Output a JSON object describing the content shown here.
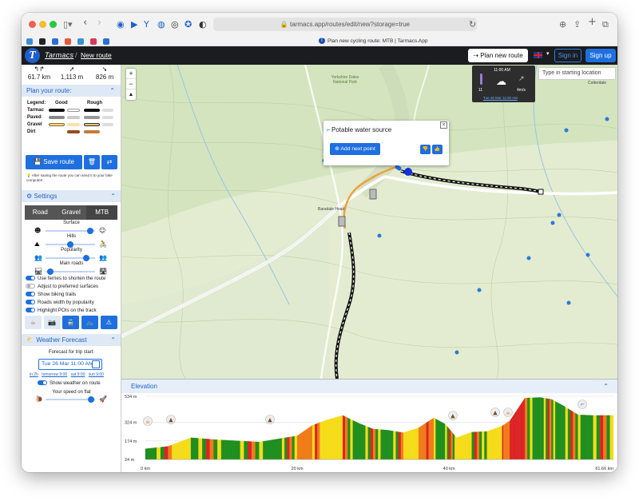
{
  "browser": {
    "url": "tarmacs.app/routes/edit/new?storage=true",
    "tab_title": "Plan new cycling route: MTB | Tarmacs.App"
  },
  "header": {
    "logo_letter": "T",
    "brand": "Tarmacs",
    "separator": "/",
    "breadcrumb": "New route",
    "plan_button": "Plan new route",
    "signin": "Sign in",
    "signup": "Sign up"
  },
  "stats": {
    "distance": "61.7 km",
    "ascent": "1,113 m",
    "descent": "826 m"
  },
  "plan": {
    "title": "Plan your route:",
    "legend_label": "Legend:",
    "good_label": "Good",
    "rough_label": "Rough",
    "surfaces": [
      "Tarmac",
      "Paved",
      "Gravel",
      "Dirt"
    ],
    "save_button": "Save route",
    "hint": "After saving the route you can send it to your bike computer!"
  },
  "settings": {
    "title": "Settings",
    "modes": [
      "Road",
      "Gravel",
      "MTB"
    ],
    "active_mode": "MTB",
    "sliders": [
      {
        "label": "Surface",
        "value": 0.9
      },
      {
        "label": "Hills",
        "value": 0.5
      },
      {
        "label": "Popularity",
        "value": 0.82
      },
      {
        "label": "Main roads",
        "value": 0.1
      }
    ],
    "toggles": [
      {
        "label": "Use ferries to shorten the route",
        "on": true
      },
      {
        "label": "Adjust to preferred surfaces",
        "on": false
      },
      {
        "label": "Show biking trails",
        "on": true
      },
      {
        "label": "Roads width by popularity",
        "on": true
      },
      {
        "label": "Highlight POIs on the track",
        "on": true
      }
    ]
  },
  "weather_panel": {
    "title": "Weather Forecast",
    "trip_label": "Forecast for trip start:",
    "date": "Tue 26 Mar 11:00 AM",
    "quick_links": [
      "in 2h",
      "tomorrow 9:00",
      "sat 9:00",
      "sun 9:00"
    ],
    "show_toggle": "Show weather on route",
    "speed_label": "Your speed on flat",
    "speed_value": 0.92
  },
  "map": {
    "search_placeholder": "Type in starting location",
    "popup_title": "Potable water source",
    "popup_button": "Add next point",
    "widget_time": "11:00 AM",
    "widget_temp": "11",
    "widget_wind": "4m/s",
    "widget_date": "Tue 26 Mar 11:00 AM",
    "place_labels": [
      "Yorkshire Dales National Park",
      "Baradale Head",
      "Cotterdale"
    ]
  },
  "elevation": {
    "title": "Elevation",
    "y_ticks": [
      "534 m",
      "324 m",
      "174 m",
      "24 m"
    ],
    "x_ticks": [
      "0 km",
      "20 km",
      "40 km",
      "61.66 km"
    ]
  },
  "chart_data": {
    "type": "area",
    "title": "Elevation",
    "xlabel": "",
    "ylabel": "",
    "xlim": [
      0,
      61.66
    ],
    "ylim": [
      24,
      534
    ],
    "x": [
      0,
      3,
      6,
      9,
      12,
      15,
      18,
      20,
      22,
      24,
      26,
      28,
      30,
      32,
      34,
      36,
      38,
      39.5,
      41,
      43,
      45,
      47,
      48,
      50,
      52,
      53.5,
      55,
      57,
      59,
      61.66
    ],
    "y": [
      110,
      130,
      200,
      185,
      175,
      165,
      195,
      215,
      300,
      345,
      380,
      320,
      270,
      260,
      240,
      280,
      360,
      310,
      200,
      245,
      250,
      295,
      335,
      520,
      525,
      510,
      460,
      385,
      380,
      380
    ],
    "colors": {
      "good": "#1f8f1f",
      "medium": "#f5dc1a",
      "steep": "#f07b1a",
      "severe": "#dc2424"
    }
  }
}
